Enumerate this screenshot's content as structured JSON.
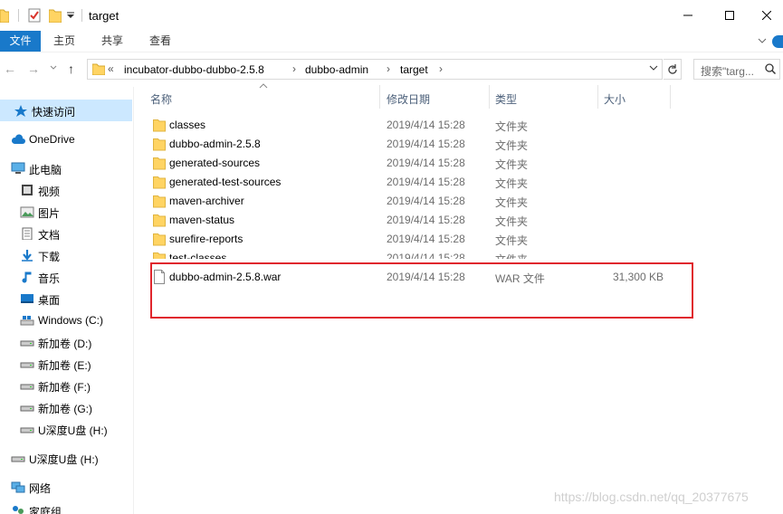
{
  "window": {
    "title": "target"
  },
  "ribbon": {
    "tabs": [
      "文件",
      "主页",
      "共享",
      "查看"
    ]
  },
  "address": {
    "prefix": "«",
    "crumbs": [
      "incubator-dubbo-dubbo-2.5.8",
      "dubbo-admin",
      "target"
    ],
    "search_placeholder": "搜索\"targ..."
  },
  "nav": {
    "items": [
      {
        "label": "快速访问",
        "icon": "star-pin-icon",
        "selected": true
      },
      {
        "label": "OneDrive",
        "icon": "cloud-icon"
      },
      {
        "label": "此电脑",
        "icon": "computer-icon"
      },
      {
        "label": "视频",
        "icon": "video-icon"
      },
      {
        "label": "图片",
        "icon": "pictures-icon"
      },
      {
        "label": "文档",
        "icon": "documents-icon"
      },
      {
        "label": "下载",
        "icon": "download-icon"
      },
      {
        "label": "音乐",
        "icon": "music-icon"
      },
      {
        "label": "桌面",
        "icon": "desktop-icon"
      },
      {
        "label": "Windows (C:)",
        "icon": "windows-drive-icon"
      },
      {
        "label": "新加卷 (D:)",
        "icon": "drive-icon"
      },
      {
        "label": "新加卷 (E:)",
        "icon": "drive-icon"
      },
      {
        "label": "新加卷 (F:)",
        "icon": "drive-icon"
      },
      {
        "label": "新加卷 (G:)",
        "icon": "drive-icon"
      },
      {
        "label": "U深度U盘 (H:)",
        "icon": "usb-drive-icon"
      },
      {
        "label": "U深度U盘 (H:)",
        "icon": "usb-drive-icon"
      },
      {
        "label": "网络",
        "icon": "network-icon"
      },
      {
        "label": "家庭组",
        "icon": "homegroup-icon"
      }
    ]
  },
  "columns": {
    "name": "名称",
    "date": "修改日期",
    "type": "类型",
    "size": "大小"
  },
  "files": [
    {
      "name": "classes",
      "date": "2019/4/14 15:28",
      "type": "文件夹",
      "size": "",
      "kind": "folder"
    },
    {
      "name": "dubbo-admin-2.5.8",
      "date": "2019/4/14 15:28",
      "type": "文件夹",
      "size": "",
      "kind": "folder"
    },
    {
      "name": "generated-sources",
      "date": "2019/4/14 15:28",
      "type": "文件夹",
      "size": "",
      "kind": "folder"
    },
    {
      "name": "generated-test-sources",
      "date": "2019/4/14 15:28",
      "type": "文件夹",
      "size": "",
      "kind": "folder"
    },
    {
      "name": "maven-archiver",
      "date": "2019/4/14 15:28",
      "type": "文件夹",
      "size": "",
      "kind": "folder"
    },
    {
      "name": "maven-status",
      "date": "2019/4/14 15:28",
      "type": "文件夹",
      "size": "",
      "kind": "folder"
    },
    {
      "name": "surefire-reports",
      "date": "2019/4/14 15:28",
      "type": "文件夹",
      "size": "",
      "kind": "folder"
    },
    {
      "name": "test-classes",
      "date": "2019/4/14 15:28",
      "type": "文件夹",
      "size": "",
      "kind": "folder"
    },
    {
      "name": "dubbo-admin-2.5.8.war",
      "date": "2019/4/14 15:28",
      "type": "WAR 文件",
      "size": "31,300 KB",
      "kind": "file"
    }
  ],
  "watermark": "https://blog.csdn.net/qq_20377675",
  "colors": {
    "accent": "#1979ca",
    "selection": "#cce8ff",
    "folder": "#ffd463",
    "highlight": "#e0262d"
  }
}
